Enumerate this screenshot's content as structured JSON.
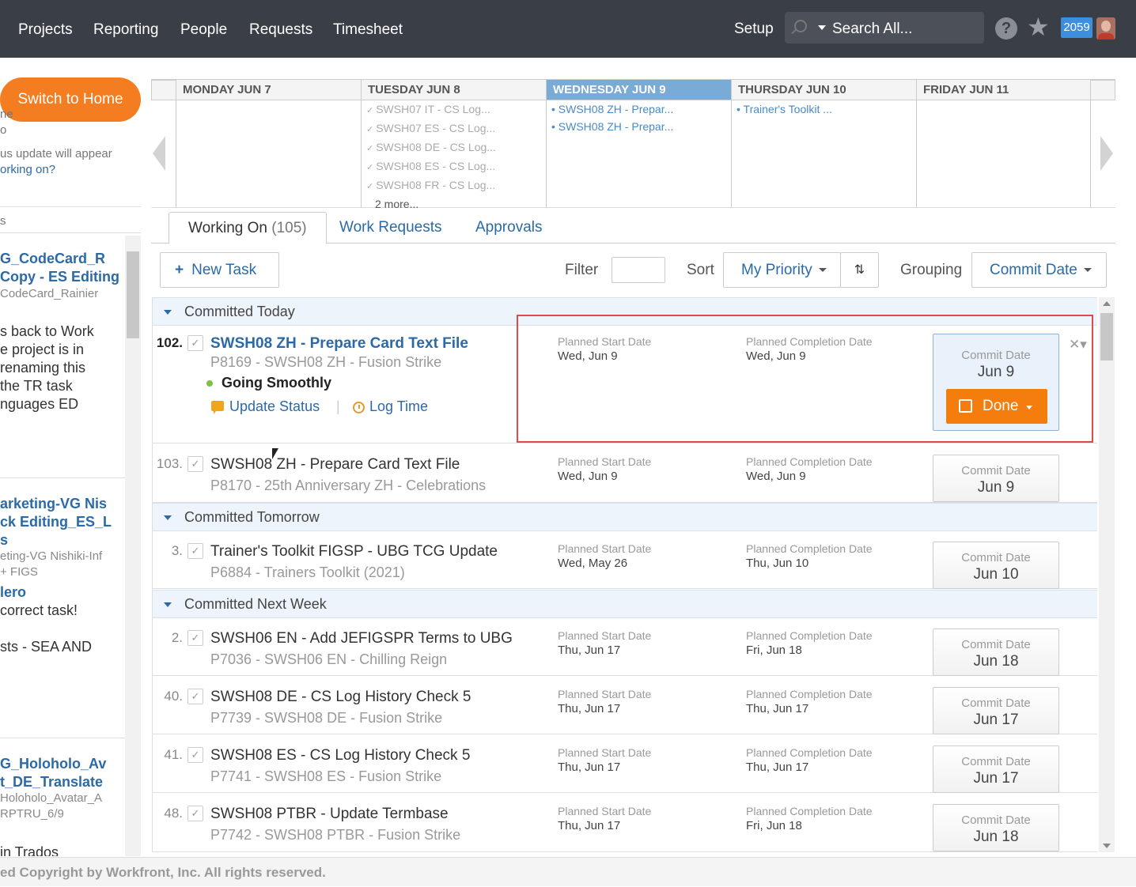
{
  "nav": {
    "items": [
      "Projects",
      "Reporting",
      "People",
      "Requests",
      "Timesheet"
    ],
    "setup": "Setup",
    "search_placeholder": "Search All...",
    "badge": "2059"
  },
  "sidebar": {
    "switch_label": "Switch to Home",
    "frag1": "ne",
    "frag2": "o",
    "frag3": "us update will appear",
    "frag4": "orking on?",
    "frag5": "s",
    "t1_a": "G_CodeCard_R",
    "t1_b": "Copy - ES Editing",
    "t1_c": "CodeCard_Rainier",
    "n1": "s back to Work",
    "n2": "e project is in",
    "n3": "renaming this",
    "n4": "the TR task",
    "n5": "nguages ED",
    "t2_a": "arketing-VG Nis",
    "t2_b": "ck Editing_ES_L",
    "t2_c": "s",
    "t2_d": "eting-VG Nishiki-Inf",
    "t2_e": "+ FIGS",
    "t2_f": "lero",
    "t2_g": "correct task!",
    "t2_h": "sts - SEA AND",
    "t3_a": "G_Holoholo_Av",
    "t3_b": "t_DE_Translate",
    "t3_c": "Holoholo_Avatar_A",
    "t3_d": "RPTRU_6/9",
    "t3_e": "in Trados"
  },
  "calendar": {
    "days": [
      {
        "label": "MONDAY JUN 7",
        "items": []
      },
      {
        "label": "TUESDAY JUN 8",
        "items": [
          "SWSH07 IT - CS Log...",
          "SWSH07 ES - CS Log...",
          "SWSH08 DE - CS Log...",
          "SWSH08 ES - CS Log...",
          "SWSH08 FR - CS Log..."
        ],
        "more": "2 more..."
      },
      {
        "label": "WEDNESDAY JUN 9",
        "items": [
          "SWSH08 ZH - Prepar...",
          "SWSH08 ZH - Prepar..."
        ]
      },
      {
        "label": "THURSDAY JUN 10",
        "items": [
          "Trainer's Toolkit ..."
        ]
      },
      {
        "label": "FRIDAY JUN 11",
        "items": []
      }
    ]
  },
  "tabs": {
    "working_on": "Working On",
    "working_on_count": "(105)",
    "work_requests": "Work Requests",
    "approvals": "Approvals"
  },
  "toolbar": {
    "new_task": "New Task",
    "filter": "Filter",
    "sort": "Sort",
    "sort_value": "My Priority",
    "grouping": "Grouping",
    "grouping_value": "Commit Date"
  },
  "labels": {
    "planned_start": "Planned Start Date",
    "planned_completion": "Planned Completion Date",
    "commit_date": "Commit Date",
    "done": "Done",
    "status": "Going Smoothly",
    "update_status": "Update Status",
    "log_time": "Log Time",
    "separator": "|"
  },
  "groups": [
    "Committed Today",
    "Committed Tomorrow",
    "Committed Next Week"
  ],
  "tasks": [
    {
      "num": "102.",
      "title": "SWSH08 ZH - Prepare Card Text File",
      "project": "P8169 - SWSH08 ZH - Fusion Strike",
      "start": "Wed, Jun 9",
      "completion": "Wed, Jun 9",
      "commit": "Jun 9"
    },
    {
      "num": "103.",
      "title": "SWSH08 ZH - Prepare Card Text File",
      "project": "P8170 - 25th Anniversary ZH - Celebrations",
      "start": "Wed, Jun 9",
      "completion": "Wed, Jun 9",
      "commit": "Jun 9"
    },
    {
      "num": "3.",
      "title": "Trainer's Toolkit FIGSP - UBG TCG Update",
      "project": "P6884 - Trainers Toolkit (2021)",
      "start": "Wed, May 26",
      "completion": "Thu, Jun 10",
      "commit": "Jun 10"
    },
    {
      "num": "2.",
      "title": "SWSH06 EN - Add JEFIGSPR Terms to UBG",
      "project": "P7036 - SWSH06 EN - Chilling Reign",
      "start": "Thu, Jun 17",
      "completion": "Fri, Jun 18",
      "commit": "Jun 18"
    },
    {
      "num": "40.",
      "title": "SWSH08 DE - CS Log History Check 5",
      "project": "P7739 - SWSH08 DE - Fusion Strike",
      "start": "Thu, Jun 17",
      "completion": "Thu, Jun 17",
      "commit": "Jun 17"
    },
    {
      "num": "41.",
      "title": "SWSH08 ES - CS Log History Check 5",
      "project": "P7741 - SWSH08 ES - Fusion Strike",
      "start": "Thu, Jun 17",
      "completion": "Thu, Jun 17",
      "commit": "Jun 17"
    },
    {
      "num": "48.",
      "title": "SWSH08 PTBR - Update Termbase",
      "project": "P7742 - SWSH08 PTBR - Fusion Strike",
      "start": "Thu, Jun 17",
      "completion": "Fri, Jun 18",
      "commit": "Jun 18"
    }
  ],
  "footer": "ed Copyright by Workfront, Inc. All rights reserved."
}
